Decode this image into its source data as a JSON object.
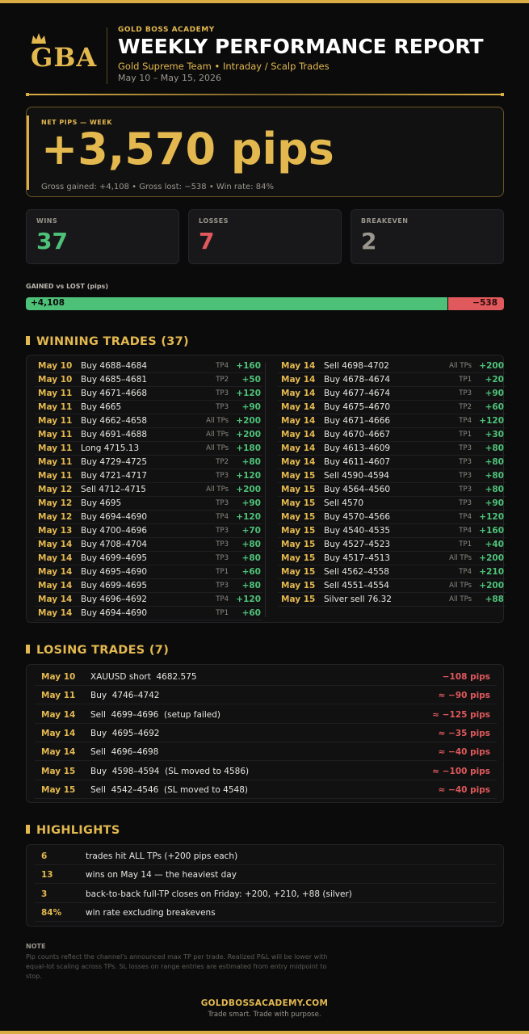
{
  "header": {
    "logo_text": "GBA",
    "brand": "GOLD BOSS ACADEMY",
    "title": "WEEKLY PERFORMANCE REPORT",
    "subtitle": "Gold Supreme Team  •  Intraday / Scalp Trades",
    "date_range": "May 10 – May 15, 2026"
  },
  "net": {
    "label": "NET PIPS — WEEK",
    "value": "+3,570 pips",
    "stats": "Gross gained: +4,108   •   Gross lost: −538   •   Win rate: 84%"
  },
  "stats": [
    {
      "label": "WINS",
      "value": "37",
      "color": "#4ec178"
    },
    {
      "label": "LOSSES",
      "value": "7",
      "color": "#e0595c"
    },
    {
      "label": "BREAKEVEN",
      "value": "2",
      "color": "#9a968d"
    }
  ],
  "bar": {
    "label": "GAINED vs LOST  (pips)",
    "gained": 4108,
    "lost": 538,
    "gained_text": "+4,108",
    "lost_text": "−538"
  },
  "winning": {
    "title": "WINNING TRADES  (37)",
    "left": [
      {
        "date": "May 10",
        "trade": "Buy 4688–4684",
        "tp": "TP4",
        "pips": "+160"
      },
      {
        "date": "May 10",
        "trade": "Buy 4685–4681",
        "tp": "TP2",
        "pips": "+50"
      },
      {
        "date": "May 11",
        "trade": "Buy 4671–4668",
        "tp": "TP3",
        "pips": "+120"
      },
      {
        "date": "May 11",
        "trade": "Buy 4665",
        "tp": "TP3",
        "pips": "+90"
      },
      {
        "date": "May 11",
        "trade": "Buy 4662–4658",
        "tp": "All TPs",
        "pips": "+200"
      },
      {
        "date": "May 11",
        "trade": "Buy 4691–4688",
        "tp": "All TPs",
        "pips": "+200"
      },
      {
        "date": "May 11",
        "trade": "Long 4715.13",
        "tp": "All TPs",
        "pips": "+180"
      },
      {
        "date": "May 11",
        "trade": "Buy 4729–4725",
        "tp": "TP2",
        "pips": "+80"
      },
      {
        "date": "May 11",
        "trade": "Buy 4721–4717",
        "tp": "TP3",
        "pips": "+120"
      },
      {
        "date": "May 12",
        "trade": "Sell 4712–4715",
        "tp": "All TPs",
        "pips": "+200"
      },
      {
        "date": "May 12",
        "trade": "Buy 4695",
        "tp": "TP3",
        "pips": "+90"
      },
      {
        "date": "May 12",
        "trade": "Buy 4694–4690",
        "tp": "TP4",
        "pips": "+120"
      },
      {
        "date": "May 13",
        "trade": "Buy 4700–4696",
        "tp": "TP3",
        "pips": "+70"
      },
      {
        "date": "May 14",
        "trade": "Buy 4708–4704",
        "tp": "TP3",
        "pips": "+80"
      },
      {
        "date": "May 14",
        "trade": "Buy 4699–4695",
        "tp": "TP3",
        "pips": "+80"
      },
      {
        "date": "May 14",
        "trade": "Buy 4695–4690",
        "tp": "TP1",
        "pips": "+60"
      },
      {
        "date": "May 14",
        "trade": "Buy 4699–4695",
        "tp": "TP3",
        "pips": "+80"
      },
      {
        "date": "May 14",
        "trade": "Buy 4696–4692",
        "tp": "TP4",
        "pips": "+120"
      },
      {
        "date": "May 14",
        "trade": "Buy 4694–4690",
        "tp": "TP1",
        "pips": "+60"
      }
    ],
    "right": [
      {
        "date": "May 14",
        "trade": "Sell 4698–4702",
        "tp": "All TPs",
        "pips": "+200"
      },
      {
        "date": "May 14",
        "trade": "Buy 4678–4674",
        "tp": "TP1",
        "pips": "+20"
      },
      {
        "date": "May 14",
        "trade": "Buy 4677–4674",
        "tp": "TP3",
        "pips": "+90"
      },
      {
        "date": "May 14",
        "trade": "Buy 4675–4670",
        "tp": "TP2",
        "pips": "+60"
      },
      {
        "date": "May 14",
        "trade": "Buy 4671–4666",
        "tp": "TP4",
        "pips": "+120"
      },
      {
        "date": "May 14",
        "trade": "Buy 4670–4667",
        "tp": "TP1",
        "pips": "+30"
      },
      {
        "date": "May 14",
        "trade": "Buy 4613–4609",
        "tp": "TP3",
        "pips": "+80"
      },
      {
        "date": "May 14",
        "trade": "Buy 4611–4607",
        "tp": "TP3",
        "pips": "+80"
      },
      {
        "date": "May 15",
        "trade": "Sell 4590–4594",
        "tp": "TP3",
        "pips": "+80"
      },
      {
        "date": "May 15",
        "trade": "Buy 4564–4560",
        "tp": "TP3",
        "pips": "+80"
      },
      {
        "date": "May 15",
        "trade": "Sell 4570",
        "tp": "TP3",
        "pips": "+90"
      },
      {
        "date": "May 15",
        "trade": "Buy 4570–4566",
        "tp": "TP4",
        "pips": "+120"
      },
      {
        "date": "May 15",
        "trade": "Buy 4540–4535",
        "tp": "TP4",
        "pips": "+160"
      },
      {
        "date": "May 15",
        "trade": "Buy 4527–4523",
        "tp": "TP1",
        "pips": "+40"
      },
      {
        "date": "May 15",
        "trade": "Buy 4517–4513",
        "tp": "All TPs",
        "pips": "+200"
      },
      {
        "date": "May 15",
        "trade": "Sell 4562–4558",
        "tp": "TP4",
        "pips": "+210"
      },
      {
        "date": "May 15",
        "trade": "Sell 4551–4554",
        "tp": "All TPs",
        "pips": "+200"
      },
      {
        "date": "May 15",
        "trade": "Silver sell 76.32",
        "tp": "All TPs",
        "pips": "+88"
      }
    ]
  },
  "losing": {
    "title": "LOSING TRADES  (7)",
    "rows": [
      {
        "date": "May 10",
        "trade": "XAUUSD short  4682.575",
        "pips": "−108 pips"
      },
      {
        "date": "May 11",
        "trade": "Buy  4746–4742",
        "pips": "≈ −90 pips"
      },
      {
        "date": "May 14",
        "trade": "Sell  4699–4696  (setup failed)",
        "pips": "≈ −125 pips"
      },
      {
        "date": "May 14",
        "trade": "Buy  4695–4692",
        "pips": "≈ −35 pips"
      },
      {
        "date": "May 14",
        "trade": "Sell  4696–4698",
        "pips": "≈ −40 pips"
      },
      {
        "date": "May 15",
        "trade": "Buy  4598–4594  (SL moved to 4586)",
        "pips": "≈ −100 pips"
      },
      {
        "date": "May 15",
        "trade": "Sell  4542–4546  (SL moved to 4548)",
        "pips": "≈ −40 pips"
      }
    ]
  },
  "highlights": {
    "title": "HIGHLIGHTS",
    "rows": [
      {
        "num": "6",
        "text": "trades hit ALL TPs (+200 pips each)"
      },
      {
        "num": "13",
        "text": "wins on May 14 — the heaviest day"
      },
      {
        "num": "3",
        "text": "back-to-back full-TP closes on Friday: +200, +210, +88 (silver)"
      },
      {
        "num": "84%",
        "text": "win rate excluding breakevens"
      }
    ]
  },
  "note": {
    "label": "NOTE",
    "text": "Pip counts reflect the channel's announced max TP per trade. Realized P&L will be lower with equal-lot scaling across TPs. SL losses on range entries are estimated from entry midpoint to stop."
  },
  "footer": {
    "site": "GOLDBOSSACADEMY.COM",
    "tagline": "Trade smart. Trade with purpose."
  }
}
